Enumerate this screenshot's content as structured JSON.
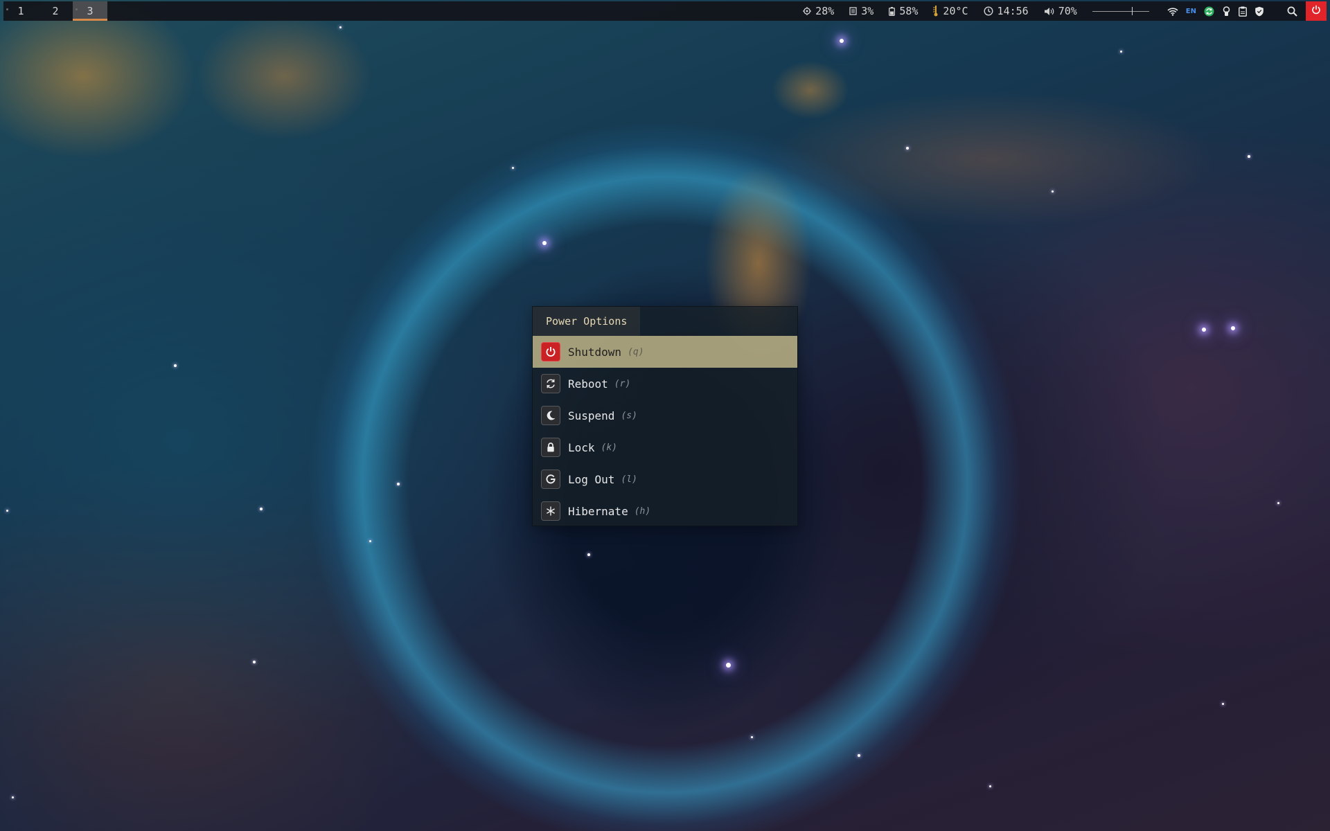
{
  "topbar": {
    "workspaces": [
      {
        "label": "1",
        "active": false
      },
      {
        "label": "2",
        "active": false
      },
      {
        "label": "3",
        "active": true
      }
    ],
    "cpu": {
      "icon": "cpu-icon",
      "value": "28%"
    },
    "memory": {
      "icon": "memory-icon",
      "value": "3%"
    },
    "battery": {
      "icon": "battery-icon",
      "value": "58%"
    },
    "temperature": {
      "icon": "thermometer-icon",
      "value": "20°C"
    },
    "clock": {
      "icon": "clock-icon",
      "value": "14:56"
    },
    "volume": {
      "icon": "speaker-icon",
      "value": "70%",
      "level": 0.7
    },
    "tray": {
      "wifi": "wifi-icon",
      "language": "EN",
      "sync": "sync-icon",
      "keyring": "keyring-icon",
      "clipboard": "clipboard-icon",
      "shield": "shield-icon",
      "search": "search-icon",
      "power": "power-icon"
    }
  },
  "power_menu": {
    "title": "Power Options",
    "items": [
      {
        "label": "Shutdown",
        "key": "(q)",
        "icon": "power-icon",
        "selected": true
      },
      {
        "label": "Reboot",
        "key": "(r)",
        "icon": "reboot-icon",
        "selected": false
      },
      {
        "label": "Suspend",
        "key": "(s)",
        "icon": "moon-icon",
        "selected": false
      },
      {
        "label": "Lock",
        "key": "(k)",
        "icon": "lock-icon",
        "selected": false
      },
      {
        "label": "Log Out",
        "key": "(l)",
        "icon": "logout-icon",
        "selected": false
      },
      {
        "label": "Hibernate",
        "key": "(h)",
        "icon": "snowflake-icon",
        "selected": false
      }
    ]
  },
  "colors": {
    "accent": "#d7894a",
    "selected_bg": "#c4ba8c",
    "power_red": "#e0242a"
  }
}
